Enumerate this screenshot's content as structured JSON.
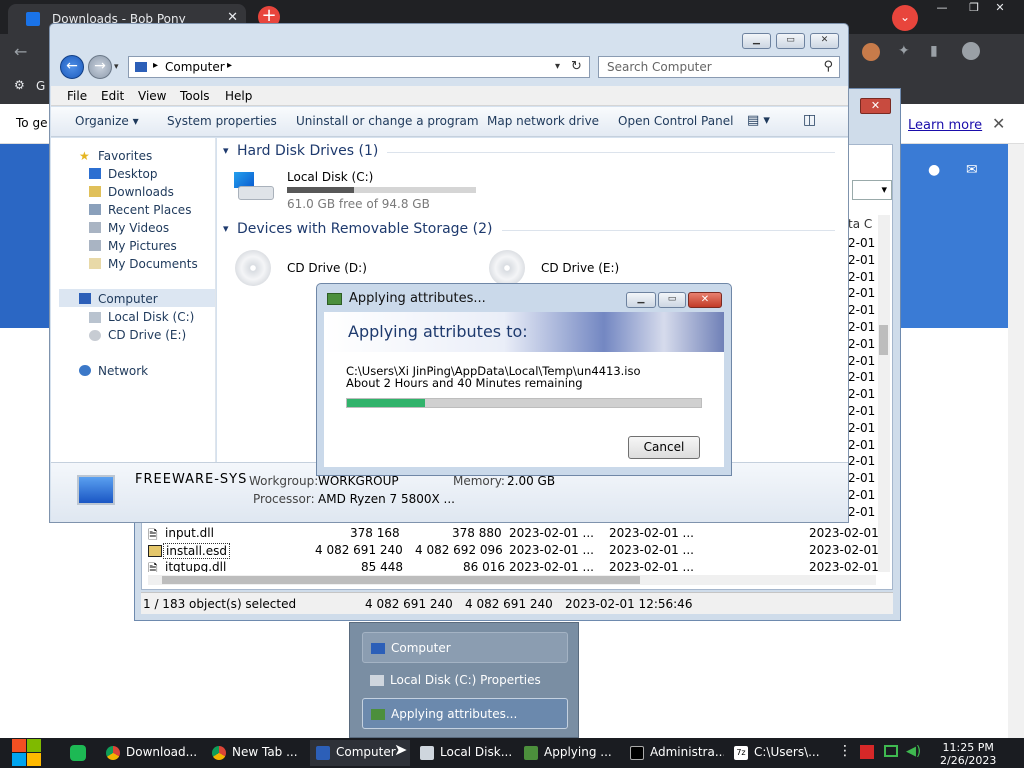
{
  "chrome": {
    "tab_title": "Downloads - Bob Pony",
    "new_tab_symbol": "+",
    "menu_symbol": "⌄",
    "bookmarks_text": "G",
    "info_text": "To ge",
    "learn_more": "Learn more",
    "close_symbol": "✕"
  },
  "props": {
    "header_col": "ta C",
    "date_cells": [
      "2-01",
      "2-01",
      "2-01",
      "2-01",
      "2-01",
      "2-01",
      "2-01",
      "2-01",
      "2-01",
      "2-01",
      "2-01",
      "2-01",
      "2-01",
      "2-01",
      "2-01",
      "2-01",
      "2-01"
    ],
    "rows": [
      {
        "name": "input.dll",
        "size": "378 168",
        "alloc": "378 880",
        "created": "2023-02-01 ...",
        "modified": "2023-02-01 ...",
        "accessed": "2023-02-01"
      },
      {
        "name": "install.esd",
        "size": "4 082 691 240",
        "alloc": "4 082 692 096",
        "created": "2023-02-01 ...",
        "modified": "2023-02-01 ...",
        "accessed": "2023-02-01"
      },
      {
        "name": "itgtupg.dll",
        "size": "85 448",
        "alloc": "86 016",
        "created": "2023-02-01 ...",
        "modified": "2023-02-01 ...",
        "accessed": "2023-02-01"
      }
    ],
    "status": {
      "selected": "1 / 183 object(s) selected",
      "size": "4 082 691 240",
      "alloc": "4 082 691 240",
      "date": "2023-02-01 12:56:46"
    }
  },
  "explorer": {
    "address": "Computer",
    "search_placeholder": "Search Computer",
    "menu": [
      "File",
      "Edit",
      "View",
      "Tools",
      "Help"
    ],
    "commands": [
      "Organize ▾",
      "System properties",
      "Uninstall or change a program",
      "Map network drive",
      "Open Control Panel"
    ],
    "nav": {
      "favorites": "Favorites",
      "desktop": "Desktop",
      "downloads": "Downloads",
      "recent": "Recent Places",
      "videos": "My Videos",
      "pictures": "My Pictures",
      "documents": "My Documents",
      "computer": "Computer",
      "local_disk": "Local Disk (C:)",
      "cd_drive": "CD Drive (E:)",
      "network": "Network"
    },
    "hard_disks_header": "Hard Disk Drives (1)",
    "removable_header": "Devices with Removable Storage (2)",
    "local_disk_name": "Local Disk (C:)",
    "local_disk_free": "61.0 GB free of 94.8 GB",
    "local_disk_used_fraction": 0.357,
    "cd_d": "CD Drive (D:)",
    "cd_e": "CD Drive (E:)",
    "details": {
      "name": "FREEWARE-SYS",
      "workgroup_label": "Workgroup:",
      "workgroup": "WORKGROUP",
      "memory_label": "Memory:",
      "memory": "2.00 GB",
      "processor_label": "Processor:",
      "processor": "AMD Ryzen 7 5800X ..."
    }
  },
  "apply": {
    "title": "Applying attributes...",
    "banner": "Applying attributes to:",
    "path": "C:\\Users\\Xi JinPing\\AppData\\Local\\Temp\\un4413.iso",
    "remaining": "About 2 Hours and 40 Minutes remaining",
    "progress_fraction": 0.22,
    "cancel": "Cancel"
  },
  "popup": {
    "items": [
      "Computer",
      "Local Disk (C:) Properties",
      "Applying attributes..."
    ]
  },
  "taskbar": {
    "items": [
      "Download...",
      "New Tab ...",
      "Computer",
      "Local Disk...",
      "Applying ...",
      "Administra...",
      "C:\\Users\\..."
    ],
    "time": "11:25 PM",
    "date": "2/26/2023"
  },
  "colors": {
    "progress": "#31b36b",
    "site_blue": "#3a7bd5",
    "chrome_dark": "#202124"
  }
}
